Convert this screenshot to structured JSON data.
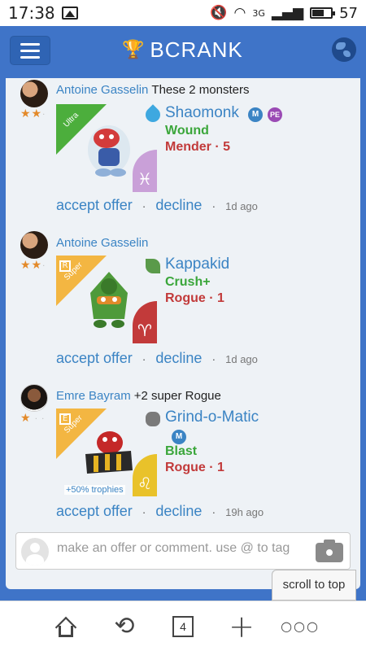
{
  "status_bar": {
    "time": "17:38",
    "signal_label": "3G",
    "battery": "57",
    "battery_level_pct": 57
  },
  "app_bar": {
    "title": "BCRANK",
    "accent_color": "#3f74c8"
  },
  "offers": [
    {
      "user": "Antoine Gasselin",
      "message": "These 2 monsters",
      "stars": "★★",
      "rarity": "Ultra",
      "monster_name": "Shaomonk",
      "element": "water",
      "badges": [
        "M",
        "PE"
      ],
      "ability": "Wound",
      "class_level": "Mender · 5",
      "zodiac": "♓",
      "accept_label": "accept offer",
      "decline_label": "decline",
      "time_ago": "1d ago"
    },
    {
      "user": "Antoine Gasselin",
      "message": "",
      "stars": "★★",
      "rarity": "Super",
      "rank_letter": "R",
      "monster_name": "Kappakid",
      "element": "plant",
      "ability": "Crush+",
      "class_level": "Rogue · 1",
      "zodiac": "♈",
      "accept_label": "accept offer",
      "decline_label": "decline",
      "time_ago": "1d ago"
    },
    {
      "user": "Emre Bayram",
      "message": "+2 super Rogue",
      "stars": "★",
      "rarity": "Super",
      "rank_letter": "E",
      "monster_name": "Grind-o-Matic",
      "element": "rock",
      "badges": [
        "M"
      ],
      "ability": "Blast",
      "class_level": "Rogue · 1",
      "zodiac": "♌",
      "bonus": "+50% trophies",
      "accept_label": "accept offer",
      "decline_label": "decline",
      "time_ago": "19h ago"
    }
  ],
  "comment": {
    "placeholder": "make an offer or comment. use @ to tag"
  },
  "scroll_top_label": "scroll to top",
  "bottom_nav": {
    "tabs_count": "4"
  },
  "colors": {
    "link": "#3b84c4",
    "ability": "#3aa63a",
    "class": "#c23a3a",
    "ultra_ribbon": "#4cae3c",
    "super_ribbon": "#f3b642"
  }
}
